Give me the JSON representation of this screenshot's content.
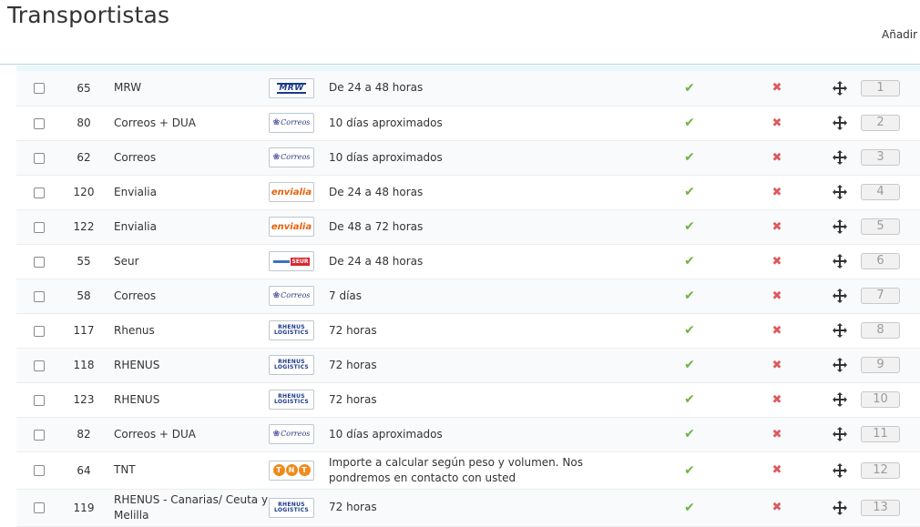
{
  "page": {
    "title": "Transportistas",
    "add_new_label": "Añadir r"
  },
  "carriers": [
    {
      "id": "65",
      "name": "MRW",
      "logo": "mrw",
      "delay": "De 24 a 48 horas",
      "active": "check-icon",
      "is_free": "x-icon",
      "position": "1"
    },
    {
      "id": "80",
      "name": "Correos + DUA",
      "logo": "correos",
      "delay": "10 días aproximados",
      "active": "check-icon",
      "is_free": "x-icon",
      "position": "2"
    },
    {
      "id": "62",
      "name": "Correos",
      "logo": "correos",
      "delay": "10 días aproximados",
      "active": "check-icon",
      "is_free": "x-icon",
      "position": "3"
    },
    {
      "id": "120",
      "name": "Envialia",
      "logo": "envialia",
      "delay": "De 24 a 48 horas",
      "active": "check-icon",
      "is_free": "x-icon",
      "position": "4"
    },
    {
      "id": "122",
      "name": "Envialia",
      "logo": "envialia",
      "delay": "De 48 a 72 horas",
      "active": "check-icon",
      "is_free": "x-icon",
      "position": "5"
    },
    {
      "id": "55",
      "name": "Seur",
      "logo": "seur",
      "delay": "De 24 a 48 horas",
      "active": "check-icon",
      "is_free": "x-icon",
      "position": "6"
    },
    {
      "id": "58",
      "name": "Correos",
      "logo": "correos",
      "delay": "7 días",
      "active": "check-icon",
      "is_free": "x-icon",
      "position": "7"
    },
    {
      "id": "117",
      "name": "Rhenus",
      "logo": "rhenus",
      "delay": "72 horas",
      "active": "check-icon",
      "is_free": "x-icon",
      "position": "8"
    },
    {
      "id": "118",
      "name": "RHENUS",
      "logo": "rhenus",
      "delay": "72 horas",
      "active": "check-icon",
      "is_free": "x-icon",
      "position": "9"
    },
    {
      "id": "123",
      "name": "RHENUS",
      "logo": "rhenus",
      "delay": "72 horas",
      "active": "check-icon",
      "is_free": "x-icon",
      "position": "10"
    },
    {
      "id": "82",
      "name": "Correos + DUA",
      "logo": "correos",
      "delay": "10 días aproximados",
      "active": "check-icon",
      "is_free": "x-icon",
      "position": "11"
    },
    {
      "id": "64",
      "name": "TNT",
      "logo": "tnt",
      "delay": "Importe a calcular según peso y volumen. Nos pondremos en contacto con usted",
      "active": "check-icon",
      "is_free": "x-icon",
      "position": "12"
    },
    {
      "id": "119",
      "name": "RHENUS - Canarias/ Ceuta y Melilla",
      "logo": "rhenus",
      "delay": "72 horas",
      "active": "check-icon",
      "is_free": "x-icon",
      "position": "13"
    }
  ],
  "logos": {
    "mrw": "MRW",
    "correos": "Correos",
    "envialia": "envialia",
    "seur": "SEUR",
    "rhenus": "RHENUS LOGISTICS",
    "tnt": "TNT"
  },
  "colors": {
    "accent": "#b6d6de",
    "check": "#72b341",
    "cross": "#e0585c"
  }
}
